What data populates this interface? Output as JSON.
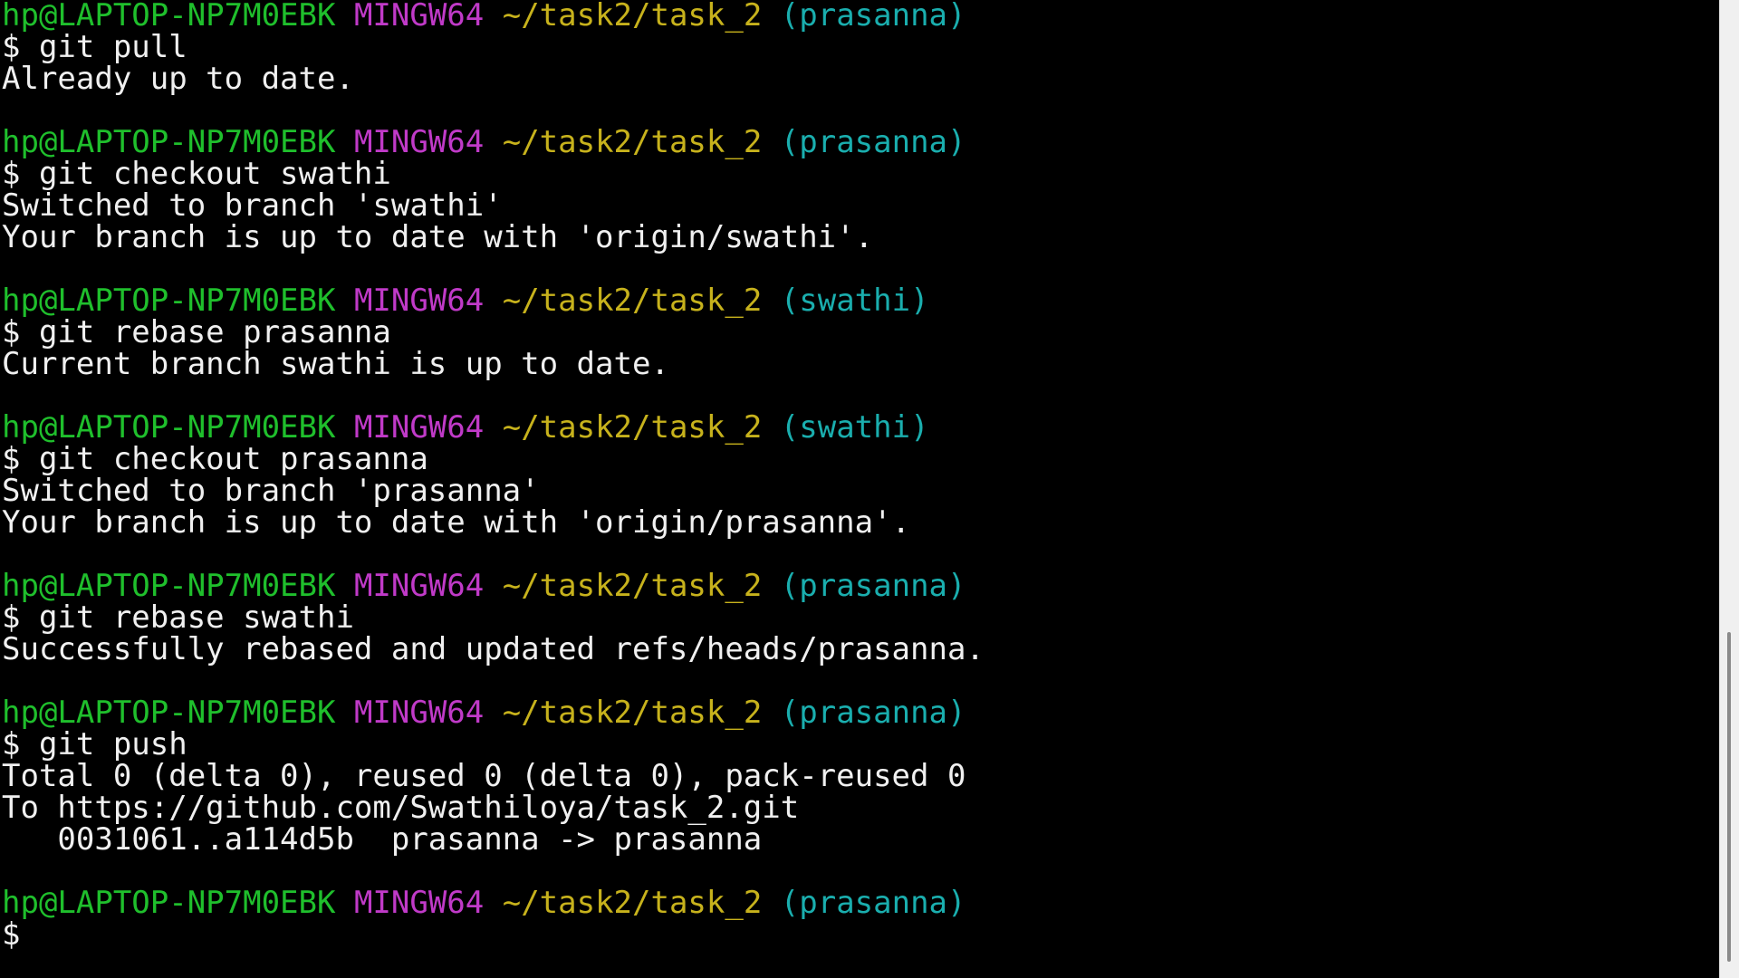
{
  "colors": {
    "background": "#000000",
    "user_host": "#1fbf2c",
    "system": "#c03ac8",
    "path": "#c7b21c",
    "branch": "#1aaeae",
    "text": "#f0f0f0"
  },
  "prompts": [
    {
      "user": "hp@LAPTOP-NP7M0EBK",
      "system": "MINGW64",
      "path": "~/task2/task_2",
      "branch": "(prasanna)",
      "command": "$ git pull",
      "output": [
        "Already up to date."
      ]
    },
    {
      "user": "hp@LAPTOP-NP7M0EBK",
      "system": "MINGW64",
      "path": "~/task2/task_2",
      "branch": "(prasanna)",
      "command": "$ git checkout swathi",
      "output": [
        "Switched to branch 'swathi'",
        "Your branch is up to date with 'origin/swathi'."
      ]
    },
    {
      "user": "hp@LAPTOP-NP7M0EBK",
      "system": "MINGW64",
      "path": "~/task2/task_2",
      "branch": "(swathi)",
      "command": "$ git rebase prasanna",
      "output": [
        "Current branch swathi is up to date."
      ]
    },
    {
      "user": "hp@LAPTOP-NP7M0EBK",
      "system": "MINGW64",
      "path": "~/task2/task_2",
      "branch": "(swathi)",
      "command": "$ git checkout prasanna",
      "output": [
        "Switched to branch 'prasanna'",
        "Your branch is up to date with 'origin/prasanna'."
      ]
    },
    {
      "user": "hp@LAPTOP-NP7M0EBK",
      "system": "MINGW64",
      "path": "~/task2/task_2",
      "branch": "(prasanna)",
      "command": "$ git rebase swathi",
      "output": [
        "Successfully rebased and updated refs/heads/prasanna."
      ]
    },
    {
      "user": "hp@LAPTOP-NP7M0EBK",
      "system": "MINGW64",
      "path": "~/task2/task_2",
      "branch": "(prasanna)",
      "command": "$ git push",
      "output": [
        "Total 0 (delta 0), reused 0 (delta 0), pack-reused 0",
        "To https://github.com/Swathiloya/task_2.git",
        "   0031061..a114d5b  prasanna -> prasanna"
      ]
    },
    {
      "user": "hp@LAPTOP-NP7M0EBK",
      "system": "MINGW64",
      "path": "~/task2/task_2",
      "branch": "(prasanna)",
      "command": "$",
      "output": []
    }
  ]
}
